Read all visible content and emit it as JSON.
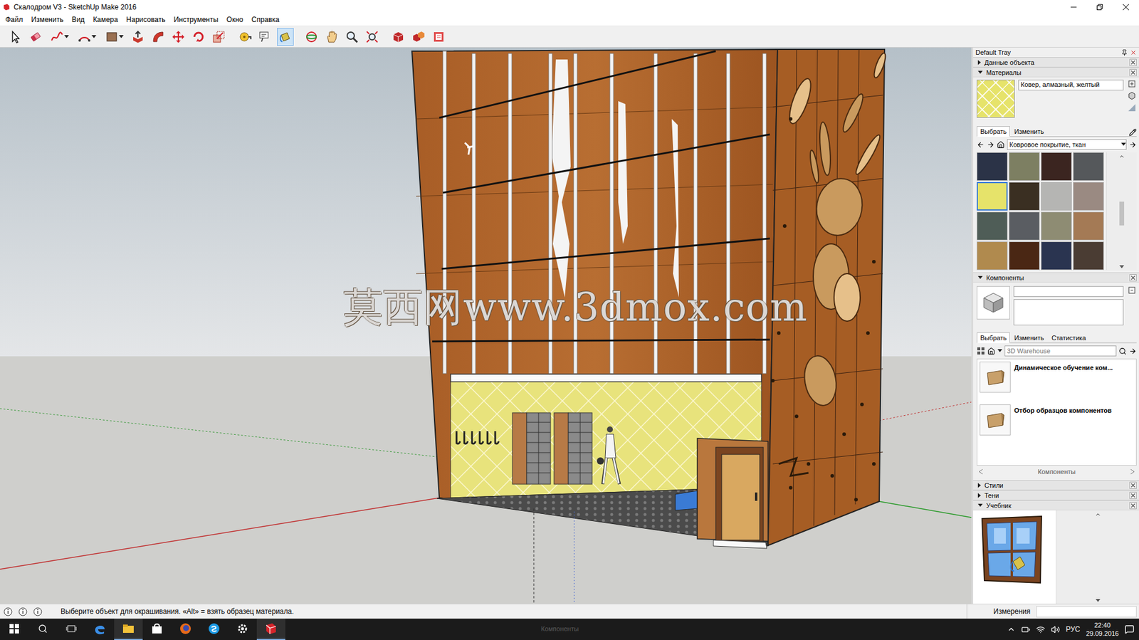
{
  "window": {
    "title": "Скалодром V3 - SketchUp Make 2016"
  },
  "menu": [
    "Файл",
    "Изменить",
    "Вид",
    "Камера",
    "Нарисовать",
    "Инструменты",
    "Окно",
    "Справка"
  ],
  "toolbar": [
    {
      "selected": false
    },
    {
      "selected": false
    },
    {
      "selected": false
    },
    {
      "selected": false
    },
    {
      "selected": false
    },
    {
      "selected": false
    },
    {
      "selected": false
    },
    {
      "selected": false
    },
    {
      "selected": false
    },
    {
      "selected": false
    },
    {
      "selected": false
    },
    {
      "selected": false
    },
    {
      "selected": true
    },
    {
      "selected": false
    },
    {
      "selected": false
    },
    {
      "selected": false
    },
    {
      "selected": false
    },
    {
      "selected": false
    },
    {
      "selected": false
    },
    {
      "selected": false
    }
  ],
  "watermark": "莫西网www.3dmox.com",
  "tray": {
    "title": "Default Tray",
    "entity_info": {
      "label": "Данные объекта",
      "expanded": false
    },
    "materials": {
      "label": "Материалы",
      "expanded": true,
      "current_name": "Ковер, алмазный, желтый",
      "tabs": [
        {
          "label": "Выбрать",
          "selected": true
        },
        {
          "label": "Изменить",
          "selected": false
        }
      ],
      "collection": "Ковровое покрытие, ткан",
      "swatches": [
        {
          "color": "#2b3347",
          "selected": false
        },
        {
          "color": "#7d7f62",
          "selected": false
        },
        {
          "color": "#3b2520",
          "selected": false
        },
        {
          "color": "#55585b",
          "selected": false
        },
        {
          "color": "#e6e36a",
          "selected": true
        },
        {
          "color": "#3a2f22",
          "selected": false
        },
        {
          "color": "#b5b5b3",
          "selected": false
        },
        {
          "color": "#9a8a82",
          "selected": false
        },
        {
          "color": "#4f5d57",
          "selected": false
        },
        {
          "color": "#5a5d62",
          "selected": false
        },
        {
          "color": "#8e8c73",
          "selected": false
        },
        {
          "color": "#a47a55",
          "selected": false
        },
        {
          "color": "#b08a4e",
          "selected": false
        },
        {
          "color": "#4a2714",
          "selected": false
        },
        {
          "color": "#2a3450",
          "selected": false
        },
        {
          "color": "#4a3c33",
          "selected": false
        }
      ]
    },
    "components": {
      "label": "Компоненты",
      "expanded": true,
      "tabs": [
        {
          "label": "Выбрать",
          "selected": true
        },
        {
          "label": "Изменить",
          "selected": false
        },
        {
          "label": "Статистика",
          "selected": false
        }
      ],
      "search": {
        "placeholder": "3D Warehouse"
      },
      "items": [
        {
          "title": "Динамическое обучение ком..."
        },
        {
          "title": "Отбор образцов компонентов"
        }
      ],
      "footer": "Компоненты"
    },
    "collapsed": [
      {
        "label": "Стили",
        "expanded": false
      },
      {
        "label": "Тени",
        "expanded": false
      }
    ],
    "instructor": {
      "label": "Учебник",
      "expanded": true
    }
  },
  "status_bar": {
    "text": "Выберите объект для окрашивания. «Alt» = взять образец материала.",
    "measurements_label": "Измерения"
  },
  "taskbar": {
    "ghost_label": "Компоненты",
    "language": "РУС",
    "time": "22:40",
    "date": "29.09.2016",
    "apps": [
      {
        "running": false
      },
      {
        "running": true
      },
      {
        "running": false
      },
      {
        "running": false
      },
      {
        "running": false
      },
      {
        "running": false
      },
      {
        "running": true
      }
    ]
  }
}
